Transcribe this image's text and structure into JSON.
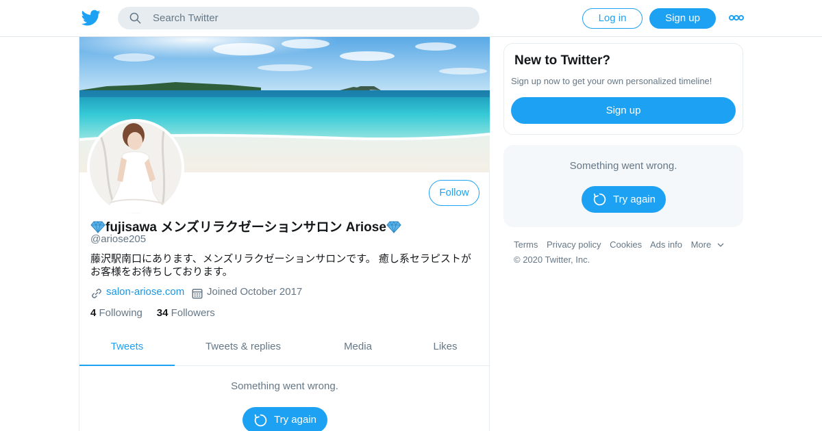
{
  "header": {
    "search_placeholder": "Search Twitter",
    "login_label": "Log in",
    "signup_label": "Sign up",
    "more_icon": "more-dots-icon",
    "logo_icon": "twitter-bird-icon"
  },
  "profile": {
    "name": "fujisawa メンズリラクゼーションサロン Ariose",
    "name_emoji": "gem-icon",
    "screen_name": "@ariose205",
    "bio": "藤沢駅南口にあります、メンズリラクゼーションサロンです。 癒し系セラピストがお客様をお待ちしております。",
    "website": "salon-ariose.com",
    "joined": "Joined October 2017",
    "following_count": "4",
    "following_label": "Following",
    "followers_count": "34",
    "followers_label": "Followers",
    "follow_button": "Follow",
    "tabs": [
      {
        "label": "Tweets",
        "active": true
      },
      {
        "label": "Tweets & replies",
        "active": false
      },
      {
        "label": "Media",
        "active": false
      },
      {
        "label": "Likes",
        "active": false
      }
    ],
    "error_text": "Something went wrong.",
    "try_again_label": "Try again"
  },
  "sidebar": {
    "signup_card": {
      "heading": "New to Twitter?",
      "subtext": "Sign up now to get your own personalized timeline!",
      "button": "Sign up"
    },
    "error_card": {
      "error_text": "Something went wrong.",
      "try_again_label": "Try again"
    }
  },
  "footer": {
    "links": [
      "Terms",
      "Privacy policy",
      "Cookies",
      "Ads info",
      "More"
    ],
    "copyright": "© 2020 Twitter, Inc."
  },
  "colors": {
    "accent": "#1da1f2",
    "secondary_text": "#657786",
    "link": "#1b95e0",
    "border": "#e6ecf0"
  }
}
